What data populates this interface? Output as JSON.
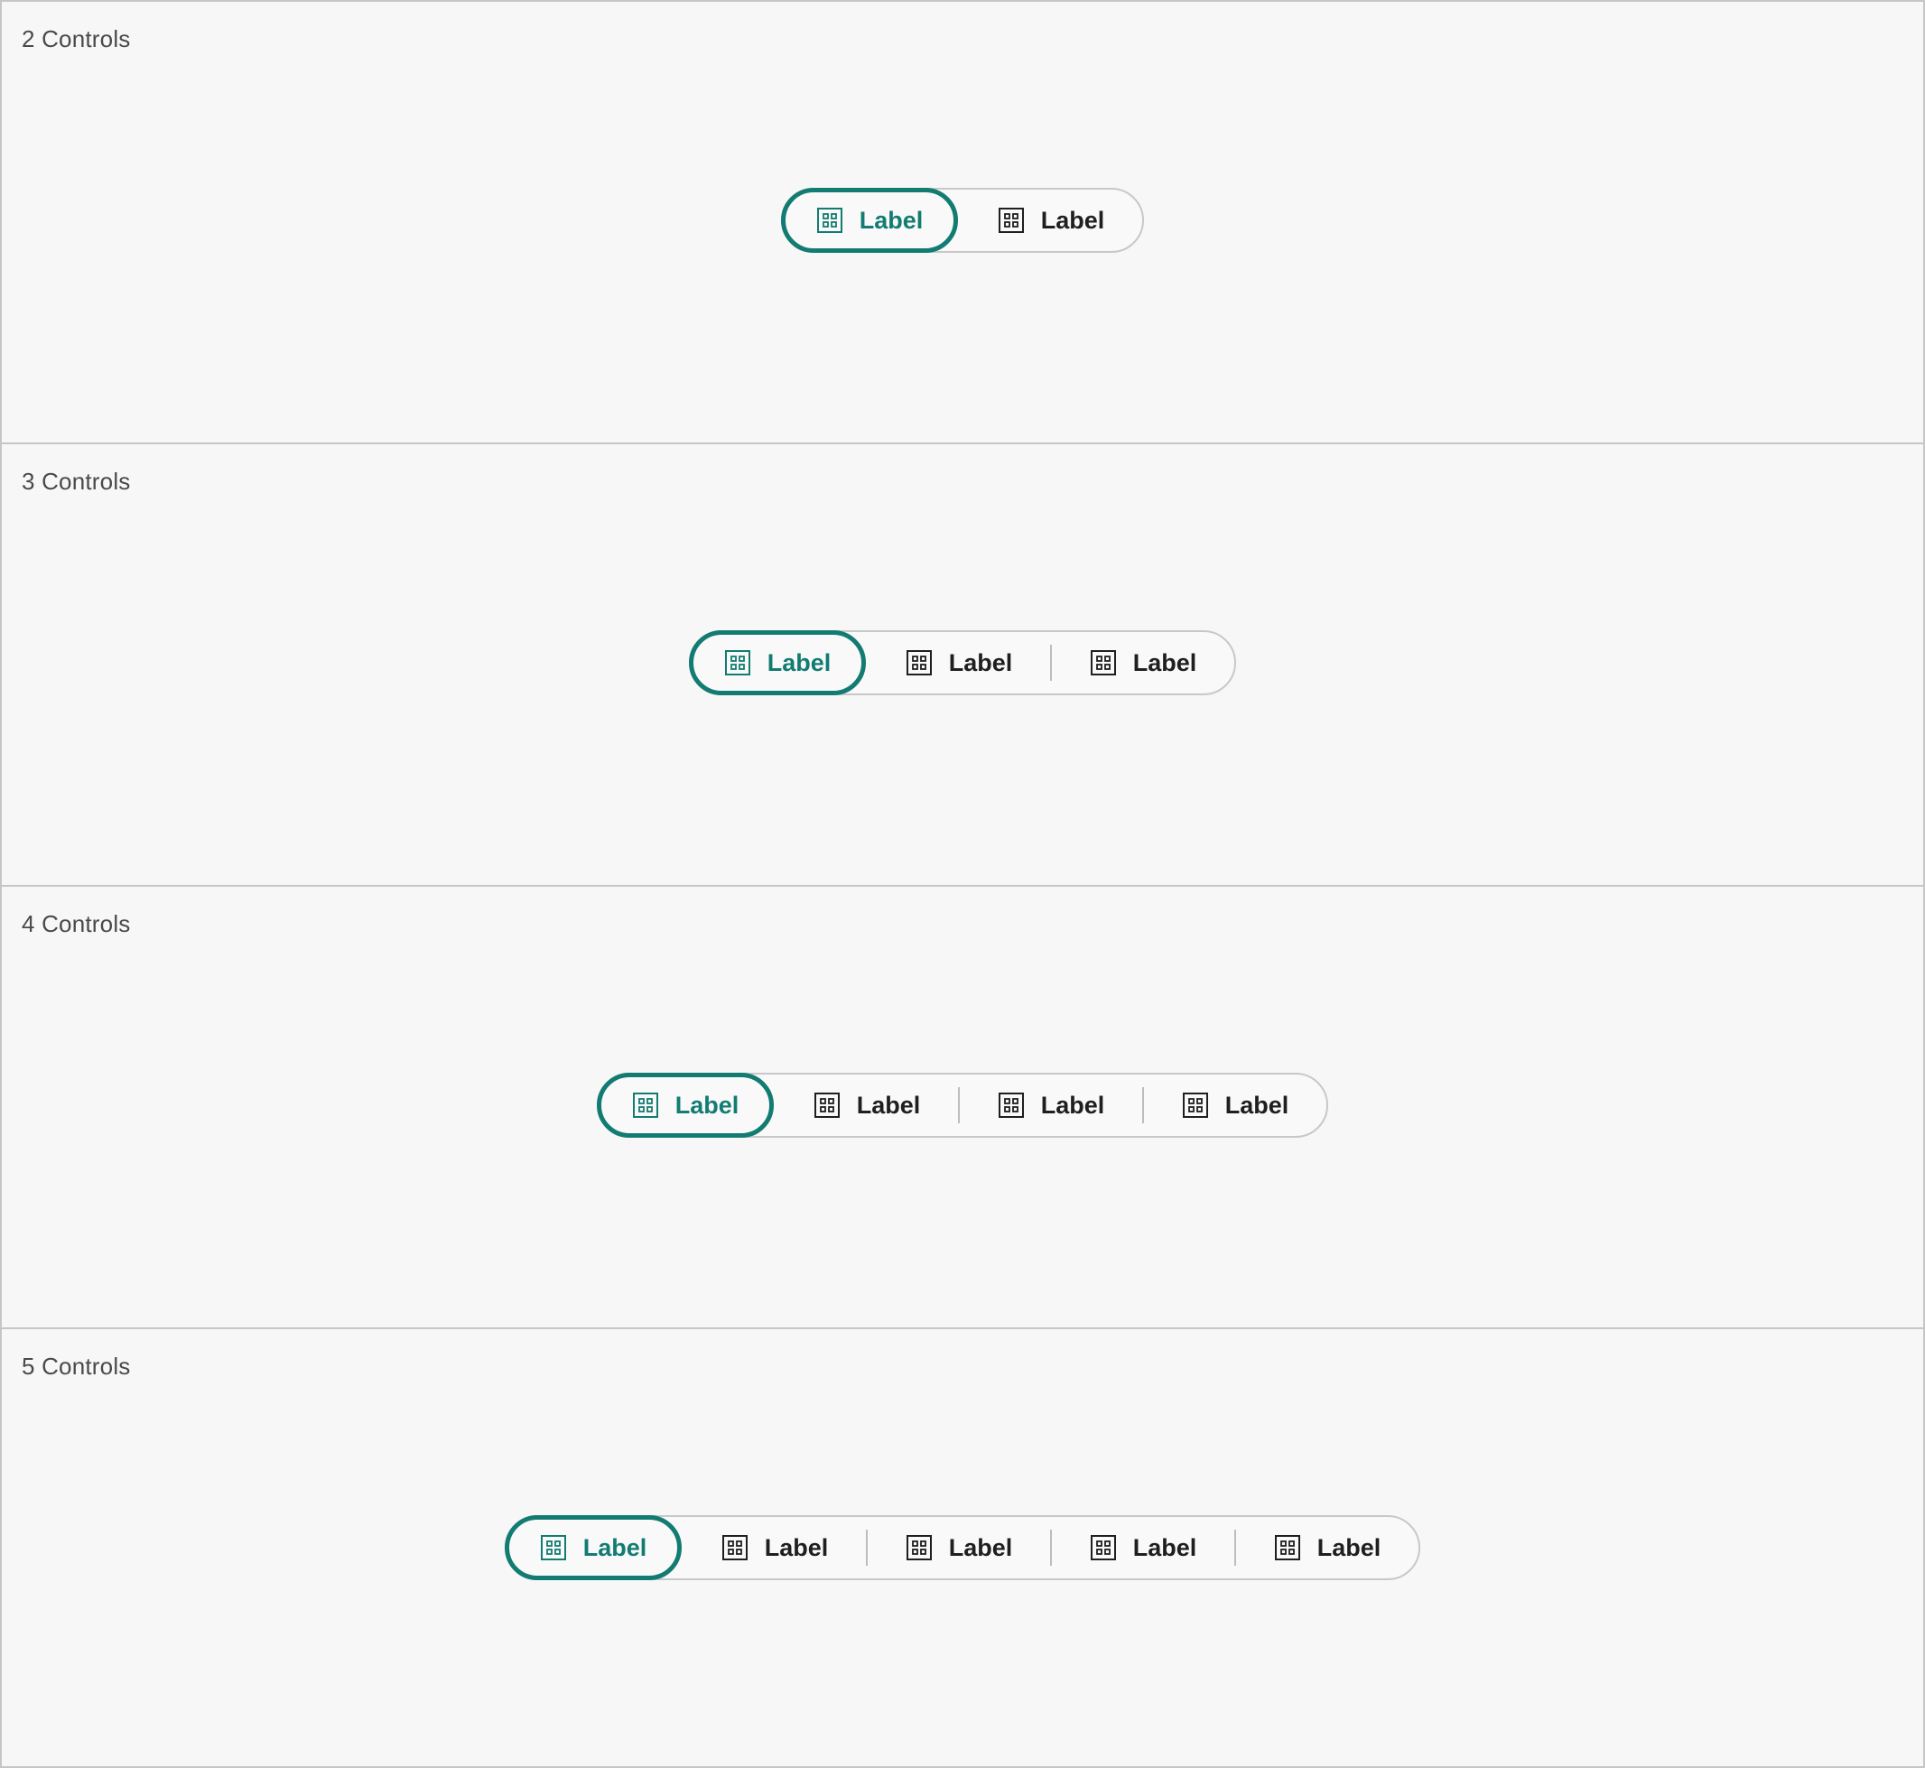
{
  "colors": {
    "accent": "#127c72",
    "text": "#1f1f1f",
    "border": "#c8c8c8",
    "background": "#f7f7f7"
  },
  "icon_name": "grid-view-icon",
  "panels": [
    {
      "title": "2 Controls",
      "items": [
        {
          "label": "Label",
          "selected": true
        },
        {
          "label": "Label",
          "selected": false
        }
      ]
    },
    {
      "title": "3 Controls",
      "items": [
        {
          "label": "Label",
          "selected": true
        },
        {
          "label": "Label",
          "selected": false
        },
        {
          "label": "Label",
          "selected": false
        }
      ]
    },
    {
      "title": "4 Controls",
      "items": [
        {
          "label": "Label",
          "selected": true
        },
        {
          "label": "Label",
          "selected": false
        },
        {
          "label": "Label",
          "selected": false
        },
        {
          "label": "Label",
          "selected": false
        }
      ]
    },
    {
      "title": "5 Controls",
      "items": [
        {
          "label": "Label",
          "selected": true
        },
        {
          "label": "Label",
          "selected": false
        },
        {
          "label": "Label",
          "selected": false
        },
        {
          "label": "Label",
          "selected": false
        },
        {
          "label": "Label",
          "selected": false
        }
      ]
    }
  ]
}
